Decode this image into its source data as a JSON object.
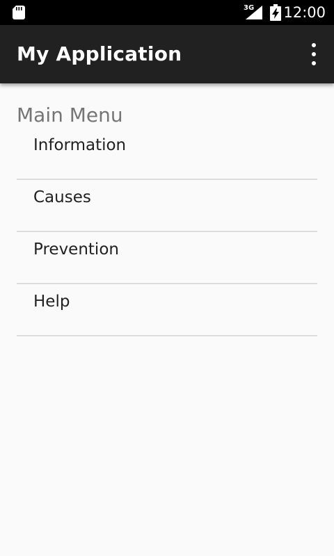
{
  "status_bar": {
    "network_type": "3G",
    "time": "12:00",
    "icons": [
      "sd-card-icon",
      "signal-icon",
      "battery-charging-icon"
    ]
  },
  "app_bar": {
    "title": "My Application",
    "overflow_icon": "more-vert-icon"
  },
  "main": {
    "heading": "Main Menu",
    "items": [
      {
        "label": "Information"
      },
      {
        "label": "Causes"
      },
      {
        "label": "Prevention"
      },
      {
        "label": "Help"
      }
    ]
  },
  "colors": {
    "status_bar": "#000000",
    "app_bar": "#212121",
    "background": "#fafafa",
    "heading_text": "#757575",
    "item_text": "#212121",
    "divider": "#dcdcdc"
  }
}
